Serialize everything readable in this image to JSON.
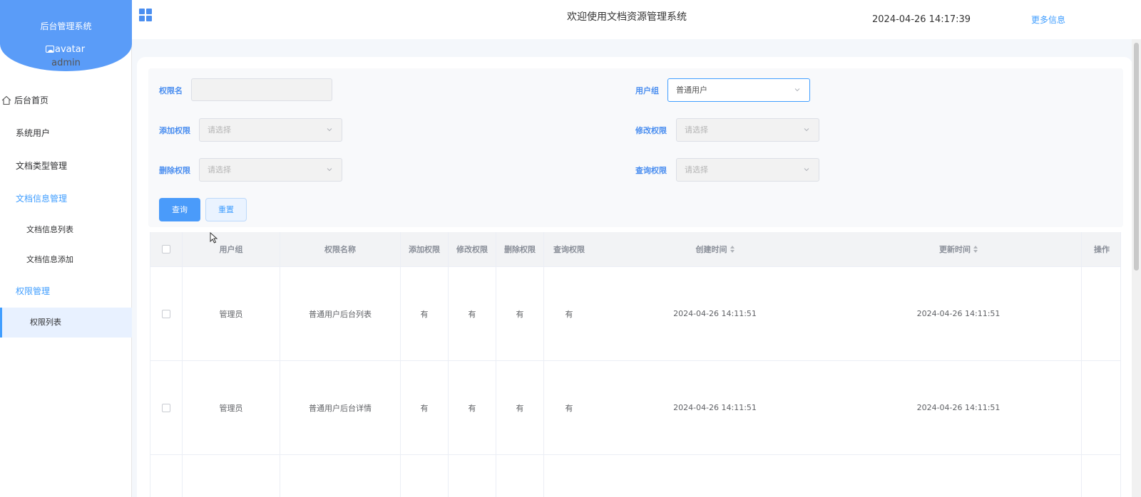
{
  "sidebar": {
    "brand_title": "后台管理系统",
    "avatar_alt": "avatar",
    "username": "admin",
    "menu": {
      "home": "后台首页",
      "sys_users": "系统用户",
      "doc_type": "文档类型管理",
      "doc_info_group": "文档信息管理",
      "doc_info_list": "文档信息列表",
      "doc_info_add": "文档信息添加",
      "perm_group": "权限管理",
      "perm_list": "权限列表"
    }
  },
  "header": {
    "welcome": "欢迎使用文档资源管理系统",
    "datetime": "2024-04-26 14:17:39",
    "more_info": "更多信息"
  },
  "search_form": {
    "perm_name_label": "权限名",
    "perm_name_value": "",
    "user_group_label": "用户组",
    "user_group_value": "普通用户",
    "add_perm_label": "添加权限",
    "edit_perm_label": "修改权限",
    "delete_perm_label": "删除权限",
    "query_perm_label": "查询权限",
    "select_placeholder": "请选择",
    "search_button": "查询",
    "reset_button": "重置"
  },
  "table": {
    "columns": {
      "user_group": "用户组",
      "perm_name": "权限名称",
      "add": "添加权限",
      "edit": "修改权限",
      "delete": "删除权限",
      "query": "查询权限",
      "created": "创建时间",
      "updated": "更新时间",
      "actions": "操作"
    },
    "rows": [
      {
        "user_group": "管理员",
        "perm_name": "普通用户后台列表",
        "add": "有",
        "edit": "有",
        "delete": "有",
        "query": "有",
        "created": "2024-04-26 14:11:51",
        "updated": "2024-04-26 14:11:51"
      },
      {
        "user_group": "管理员",
        "perm_name": "普通用户后台详情",
        "add": "有",
        "edit": "有",
        "delete": "有",
        "query": "有",
        "created": "2024-04-26 14:11:51",
        "updated": "2024-04-26 14:11:51"
      }
    ]
  },
  "colors": {
    "brand": "#5a9cf8",
    "accent": "#409eff"
  }
}
